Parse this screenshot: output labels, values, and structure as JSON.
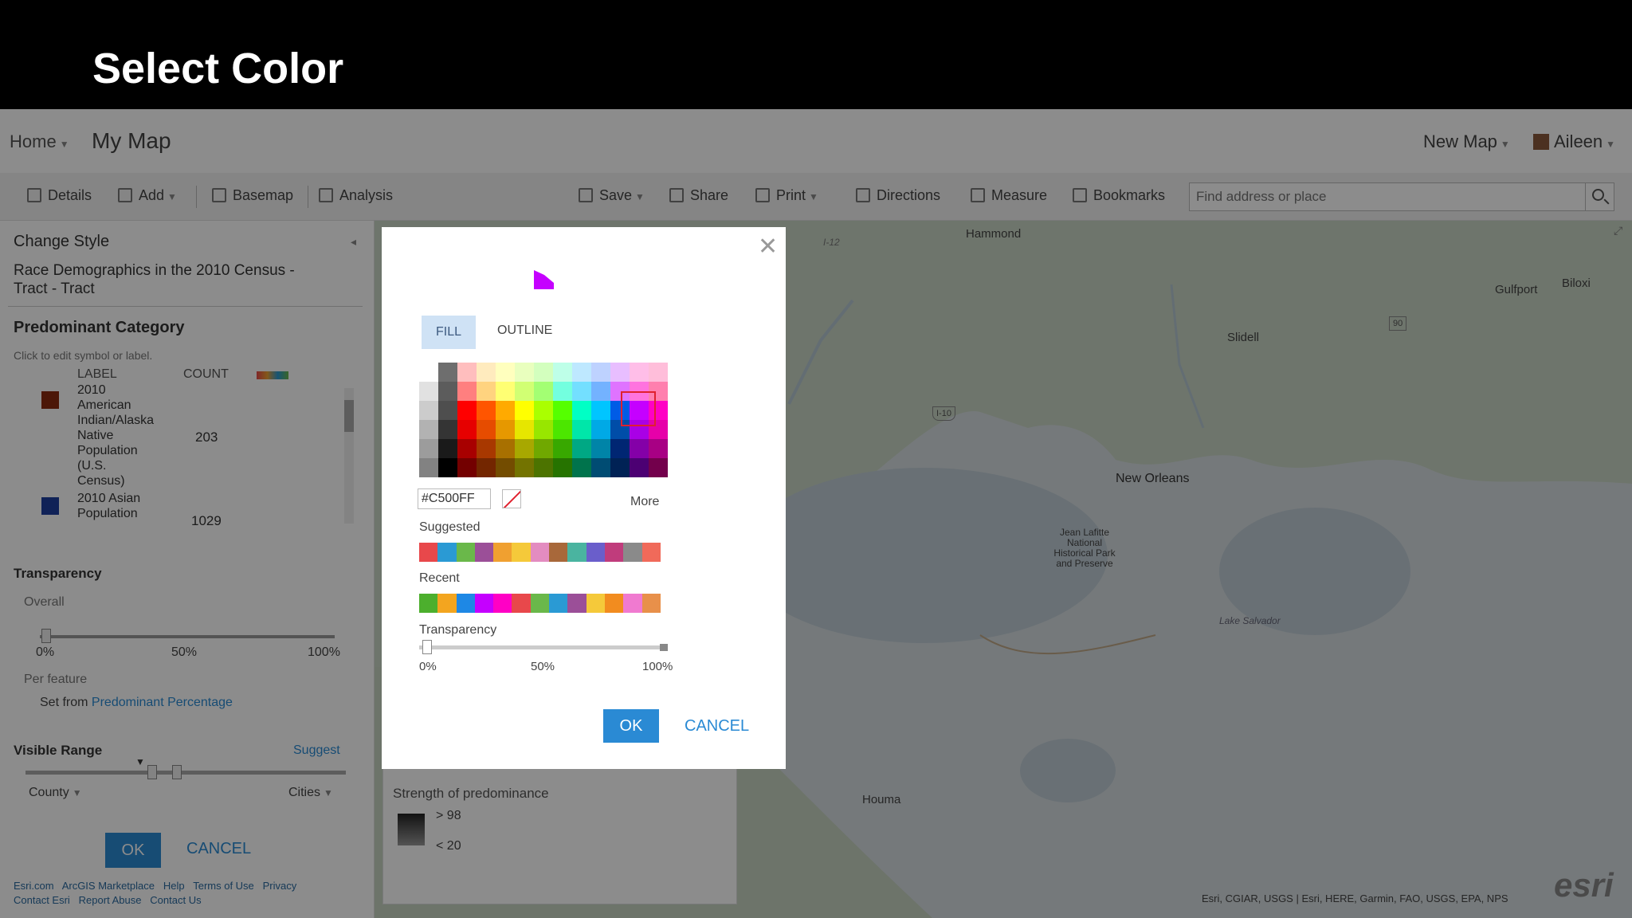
{
  "slide": {
    "title": "Select Color"
  },
  "header": {
    "home": "Home",
    "map_title": "My Map",
    "new_map": "New Map",
    "user": "Aileen"
  },
  "toolbar": {
    "details": "Details",
    "add": "Add",
    "basemap": "Basemap",
    "analysis": "Analysis",
    "save": "Save",
    "share": "Share",
    "print": "Print",
    "directions": "Directions",
    "measure": "Measure",
    "bookmarks": "Bookmarks",
    "search_placeholder": "Find address or place"
  },
  "left_panel": {
    "heading": "Change Style",
    "layer_line1": "Race Demographics in the 2010 Census -",
    "layer_line2": "Tract - Tract",
    "category_title": "Predominant Category",
    "hint": "Click to edit symbol or label.",
    "col_label": "LABEL",
    "col_count": "COUNT",
    "items": [
      {
        "lines": [
          "2010",
          "American",
          "Indian/Alaska",
          "Native",
          "Population",
          "(U.S.",
          "Census)"
        ],
        "count": "203",
        "color": "#8b2a0f"
      },
      {
        "lines": [
          "2010 Asian",
          "Population"
        ],
        "count": "1029",
        "color": "#1e3f9e"
      }
    ],
    "transparency_title": "Transparency",
    "overall": "Overall",
    "ticks": [
      "0%",
      "50%",
      "100%"
    ],
    "per_feature": "Per feature",
    "set_from_prefix": "Set from",
    "set_from_link": "Predominant Percentage",
    "visible_range": "Visible Range",
    "suggest": "Suggest",
    "range_min": "County",
    "range_max": "Cities",
    "ok": "OK",
    "cancel": "CANCEL",
    "footer_line1": [
      "Esri.com",
      "ArcGIS Marketplace",
      "Help",
      "Terms of Use",
      "Privacy"
    ],
    "footer_line2": [
      "Contact Esri",
      "Report Abuse",
      "Contact Us"
    ]
  },
  "map": {
    "cities": [
      "Hammond",
      "Gulfport",
      "Biloxi",
      "Slidell",
      "New Orleans",
      "Jean Lafitte National Historical Park and Preserve",
      "Houma",
      "Lake Salvador"
    ],
    "road_labels": [
      "I-12",
      "I-10",
      "90"
    ],
    "attribution": "Esri, CGIAR, USGS | Esri, HERE, Garmin, FAO, USGS, EPA, NPS",
    "logo": "esri"
  },
  "legend_panel": {
    "strength_title": "Strength of predominance",
    "high": "> 98",
    "low": "< 20"
  },
  "dialog": {
    "tabs": {
      "fill": "FILL",
      "outline": "OUTLINE"
    },
    "selected_color": "#C500FF",
    "hex_value": "#C500FF",
    "more": "More",
    "suggested_label": "Suggested",
    "recent_label": "Recent",
    "transparency_label": "Transparency",
    "transparency_value": 0,
    "ticks": [
      "0%",
      "50%",
      "100%"
    ],
    "ok": "OK",
    "cancel": "CANCEL",
    "palette": [
      [
        "#ffffff",
        "#6e6e6e",
        "#ffbebe",
        "#ffebbe",
        "#ffffbe",
        "#e9ffbe",
        "#d3ffbe",
        "#beffe8",
        "#bee8ff",
        "#bed2ff",
        "#e8beff",
        "#ffbee8",
        "#ffbeda"
      ],
      [
        "#e1e1e1",
        "#5c5c5c",
        "#ff7f7f",
        "#ffd37f",
        "#ffff73",
        "#d1ff73",
        "#a3ff73",
        "#73ffdf",
        "#73dfff",
        "#73b2ff",
        "#df73ff",
        "#ff73df",
        "#ff7fae"
      ],
      [
        "#cccccc",
        "#4e4e4e",
        "#ff0000",
        "#ff5500",
        "#ffaa00",
        "#ffff00",
        "#aaff00",
        "#55ff00",
        "#00ffc5",
        "#00c5ff",
        "#005ce6",
        "#c500ff",
        "#ff00c5"
      ],
      [
        "#b2b2b2",
        "#343434",
        "#e60000",
        "#e64c00",
        "#e69800",
        "#e6e600",
        "#98e600",
        "#4ce600",
        "#00e6a9",
        "#00a9e6",
        "#004da8",
        "#a900e6",
        "#e600a9"
      ],
      [
        "#9c9c9c",
        "#1a1a1a",
        "#a80000",
        "#a83800",
        "#a87000",
        "#a8a800",
        "#70a800",
        "#38a800",
        "#00a884",
        "#0084a8",
        "#002673",
        "#8400a8",
        "#a80084"
      ],
      [
        "#828282",
        "#000000",
        "#730000",
        "#732600",
        "#734c00",
        "#737300",
        "#4c7300",
        "#267300",
        "#00734c",
        "#004c73",
        "#002255",
        "#4c0073",
        "#73004c"
      ]
    ],
    "suggested": [
      "#e8484b",
      "#2a9ad4",
      "#6ab84a",
      "#9b4f98",
      "#f0a030",
      "#f5c93a",
      "#e38cc0",
      "#a8683a",
      "#4ab4a0",
      "#6a5ecb",
      "#c03c7c",
      "#8a8a8a",
      "#f06a5a"
    ],
    "recent": [
      "#4caf2d",
      "#f3a51f",
      "#1e88e5",
      "#c500ff",
      "#ff00c5",
      "#e8484b",
      "#6ab84a",
      "#2a9ad4",
      "#9b4f98",
      "#f5c93a",
      "#f28c1f",
      "#f07ad0",
      "#e8904a"
    ]
  }
}
